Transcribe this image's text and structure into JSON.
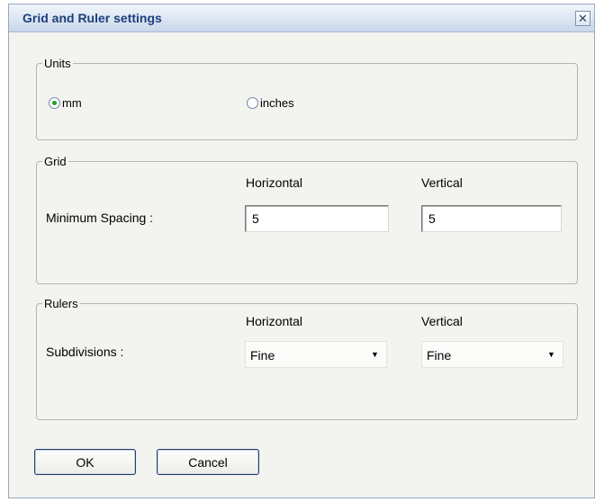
{
  "window": {
    "title": "Grid and Ruler settings"
  },
  "units": {
    "legend": "Units",
    "options": [
      {
        "label": "mm",
        "checked": true
      },
      {
        "label": "inches",
        "checked": false
      }
    ]
  },
  "grid": {
    "legend": "Grid",
    "col_horizontal": "Horizontal",
    "col_vertical": "Vertical",
    "row_label": "Minimum Spacing :",
    "horizontal_value": "5",
    "vertical_value": "5"
  },
  "rulers": {
    "legend": "Rulers",
    "col_horizontal": "Horizontal",
    "col_vertical": "Vertical",
    "row_label": "Subdivisions :",
    "horizontal_value": "Fine",
    "vertical_value": "Fine"
  },
  "buttons": {
    "ok": "OK",
    "cancel": "Cancel"
  },
  "icons": {
    "close": "close-icon",
    "dropdown": "chevron-down-icon"
  }
}
